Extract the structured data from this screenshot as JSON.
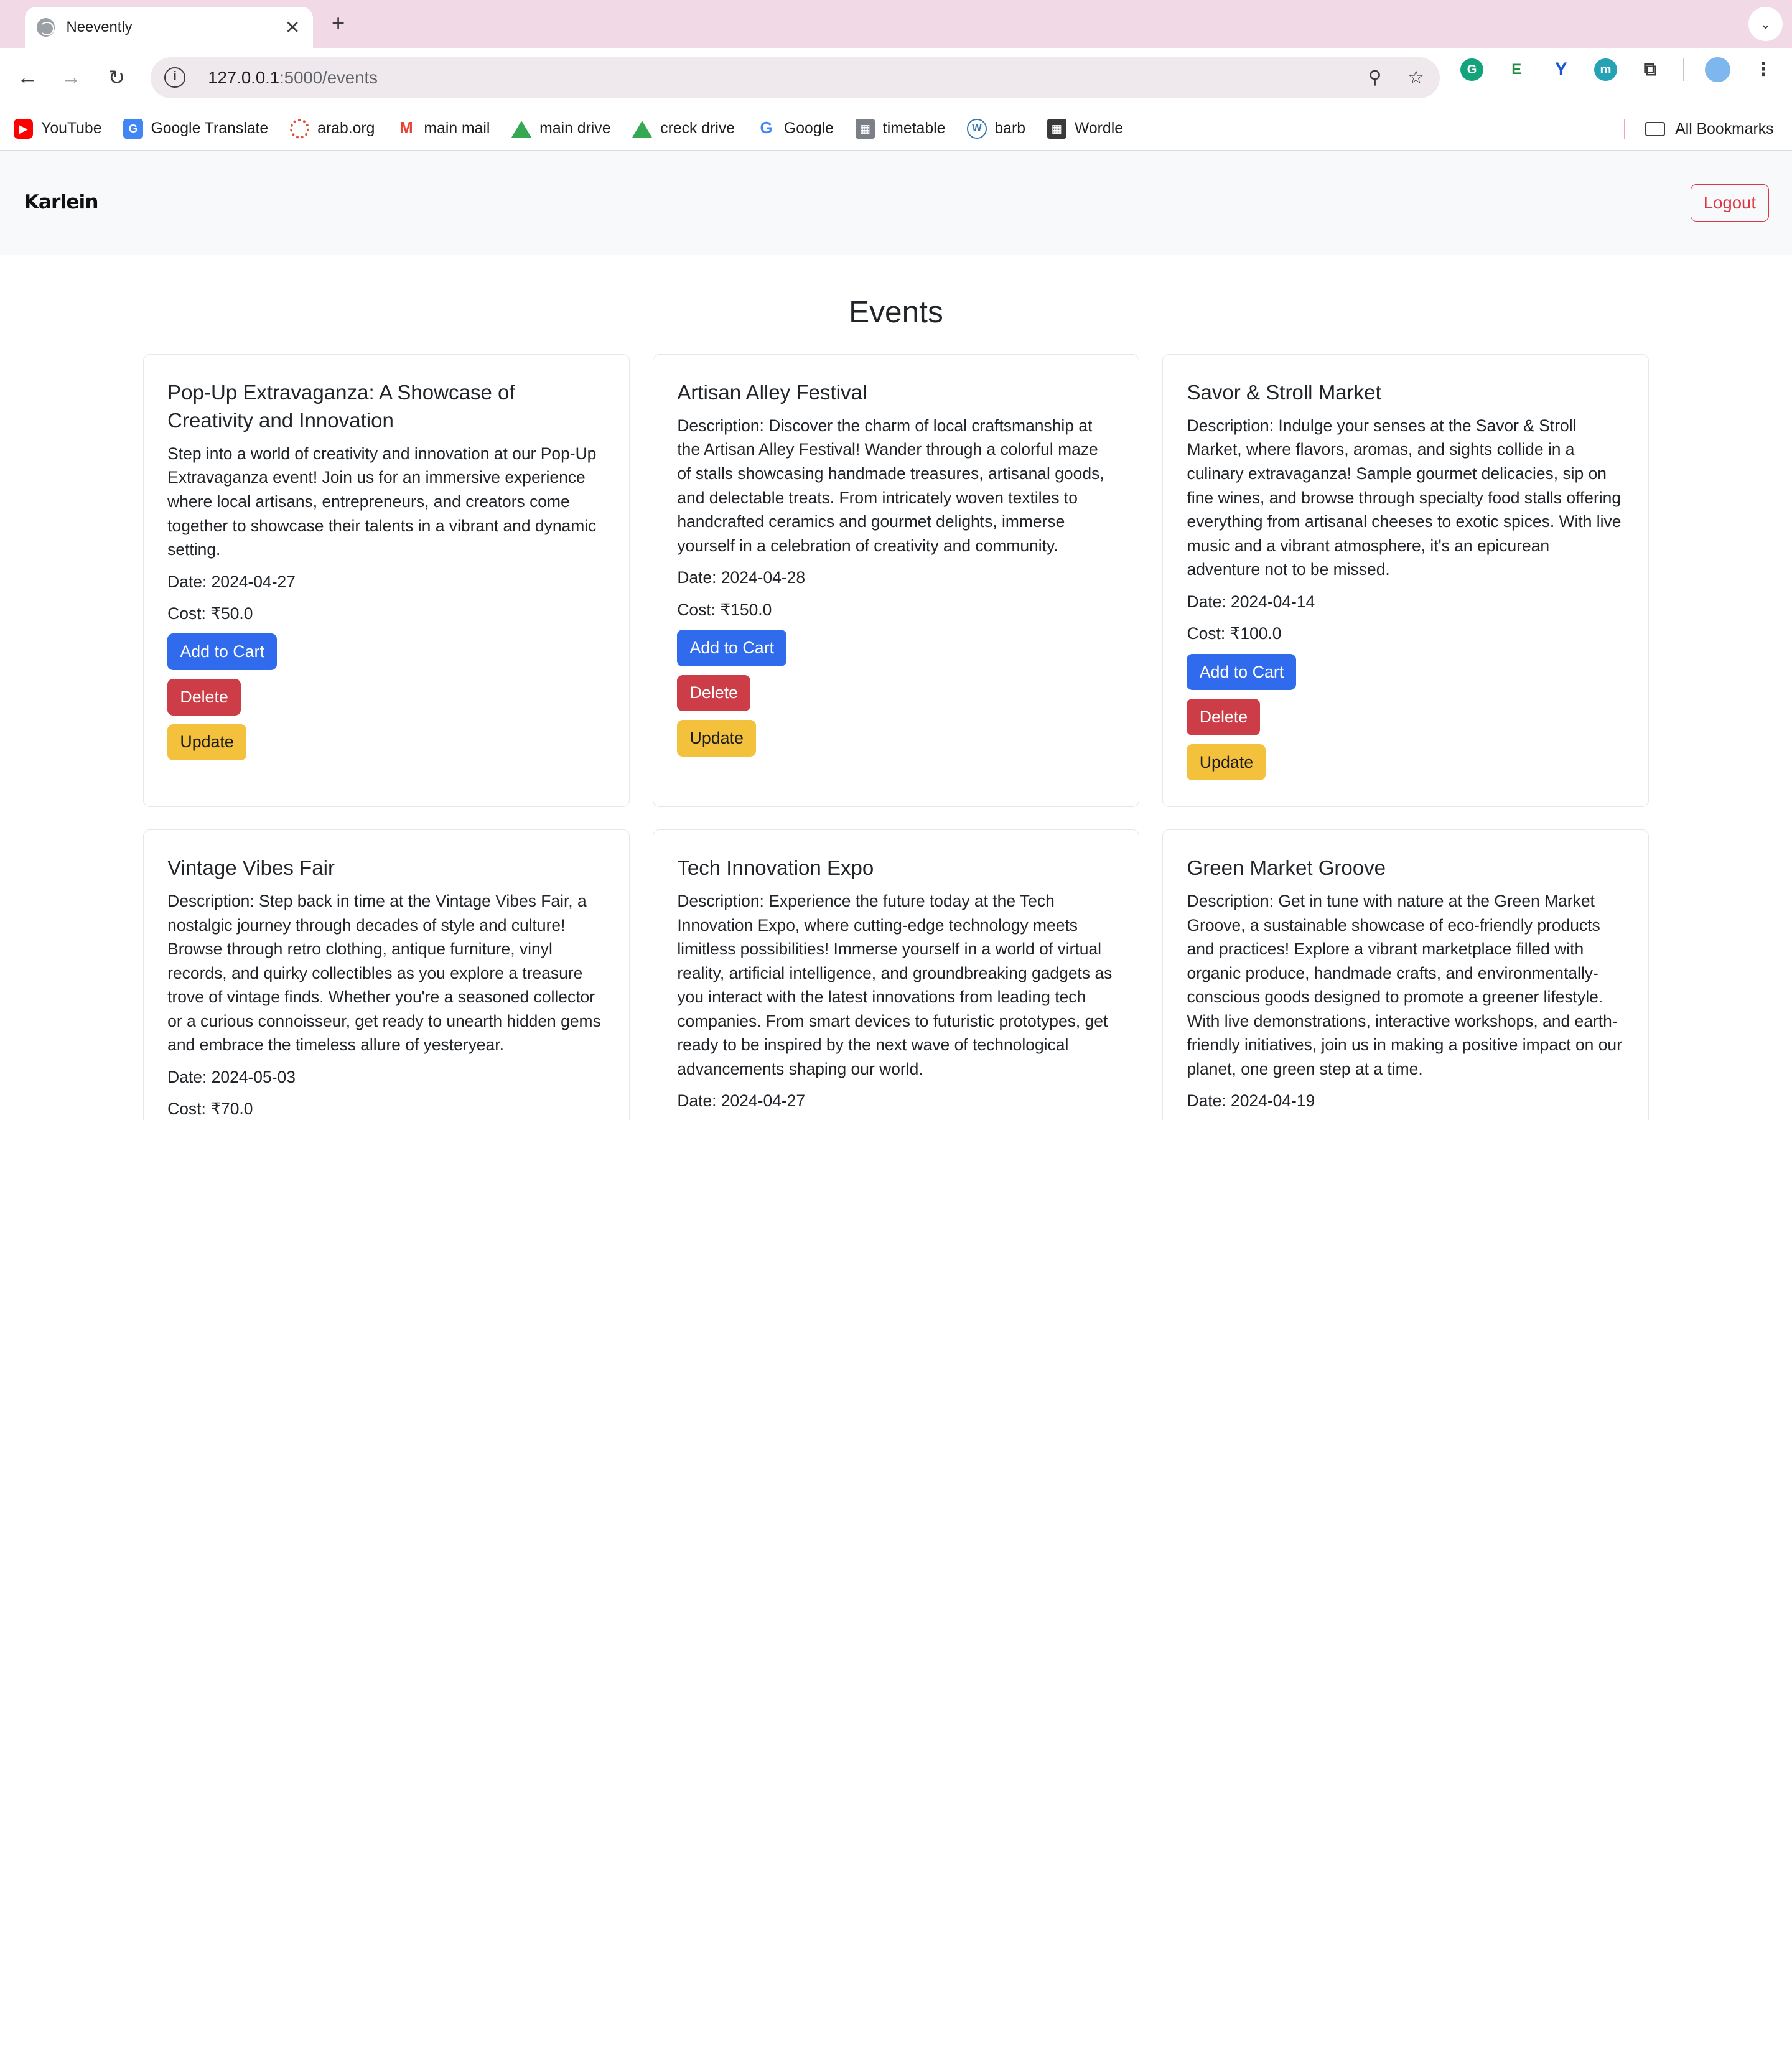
{
  "browser": {
    "tab_title": "Neevently",
    "url_host": "127.0.0.1",
    "url_rest": ":5000/events",
    "bookmarks": [
      {
        "label": "YouTube",
        "icon": "youtube-icon"
      },
      {
        "label": "Google Translate",
        "icon": "google-translate-icon"
      },
      {
        "label": "arab.org",
        "icon": "arab-org-icon"
      },
      {
        "label": "main mail",
        "icon": "gmail-icon"
      },
      {
        "label": "main drive",
        "icon": "google-drive-icon"
      },
      {
        "label": "creck drive",
        "icon": "google-drive-icon"
      },
      {
        "label": "Google",
        "icon": "google-icon"
      },
      {
        "label": "timetable",
        "icon": "building-icon"
      },
      {
        "label": "barb",
        "icon": "wordpress-icon"
      },
      {
        "label": "Wordle",
        "icon": "wordle-icon"
      }
    ],
    "all_bookmarks": "All Bookmarks"
  },
  "app": {
    "brand": "Karlein",
    "logout": "Logout",
    "page_title": "Events"
  },
  "events": [
    {
      "title": "Pop-Up Extravaganza: A Showcase of Creativity and Innovation",
      "description": "Step into a world of creativity and innovation at our Pop-Up Extravaganza event! Join us for an immersive experience where local artisans, entrepreneurs, and creators come together to showcase their talents in a vibrant and dynamic setting.",
      "date": "Date: 2024-04-27",
      "cost": "Cost: ₹50.0"
    },
    {
      "title": "Artisan Alley Festival",
      "description": "Description: Discover the charm of local craftsmanship at the Artisan Alley Festival! Wander through a colorful maze of stalls showcasing handmade treasures, artisanal goods, and delectable treats. From intricately woven textiles to handcrafted ceramics and gourmet delights, immerse yourself in a celebration of creativity and community.",
      "date": "Date: 2024-04-28",
      "cost": "Cost: ₹150.0"
    },
    {
      "title": "Savor & Stroll Market",
      "description": "Description: Indulge your senses at the Savor & Stroll Market, where flavors, aromas, and sights collide in a culinary extravaganza! Sample gourmet delicacies, sip on fine wines, and browse through specialty food stalls offering everything from artisanal cheeses to exotic spices. With live music and a vibrant atmosphere, it's an epicurean adventure not to be missed.",
      "date": "Date: 2024-04-14",
      "cost": "Cost: ₹100.0"
    },
    {
      "title": "Vintage Vibes Fair",
      "description": "Description: Step back in time at the Vintage Vibes Fair, a nostalgic journey through decades of style and culture! Browse through retro clothing, antique furniture, vinyl records, and quirky collectibles as you explore a treasure trove of vintage finds. Whether you're a seasoned collector or a curious connoisseur, get ready to unearth hidden gems and embrace the timeless allure of yesteryear.",
      "date": "Date: 2024-05-03",
      "cost": "Cost: ₹70.0"
    },
    {
      "title": "Tech Innovation Expo",
      "description": "Description: Experience the future today at the Tech Innovation Expo, where cutting-edge technology meets limitless possibilities! Immerse yourself in a world of virtual reality, artificial intelligence, and groundbreaking gadgets as you interact with the latest innovations from leading tech companies. From smart devices to futuristic prototypes, get ready to be inspired by the next wave of technological advancements shaping our world.",
      "date": "Date: 2024-04-27",
      "cost": ""
    },
    {
      "title": "Green Market Groove",
      "description": "Description: Get in tune with nature at the Green Market Groove, a sustainable showcase of eco-friendly products and practices! Explore a vibrant marketplace filled with organic produce, handmade crafts, and environmentally-conscious goods designed to promote a greener lifestyle. With live demonstrations, interactive workshops, and earth-friendly initiatives, join us in making a positive impact on our planet, one green step at a time.",
      "date": "Date: 2024-04-19",
      "cost": ""
    }
  ],
  "buttons": {
    "add_to_cart": "Add to Cart",
    "delete": "Delete",
    "update": "Update"
  },
  "colors": {
    "primary": "#2f6bec",
    "danger": "#cc3d47",
    "warning": "#f4c13c",
    "tabstrip": "#f1d9e6"
  }
}
